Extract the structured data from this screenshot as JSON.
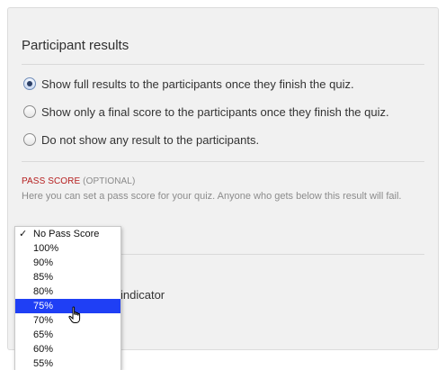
{
  "participant_results": {
    "title": "Participant results",
    "options": [
      {
        "label": "Show full results to the participants once they finish the quiz.",
        "checked": true
      },
      {
        "label": "Show only a final score to the participants once they finish the quiz.",
        "checked": false
      },
      {
        "label": "Do not show any result to the participants.",
        "checked": false
      }
    ]
  },
  "pass_score": {
    "heading": "PASS SCORE",
    "optional_tag": "(OPTIONAL)",
    "help": "Here you can set a pass score for your quiz. Anyone who gets below this result will fail.",
    "dropdown": {
      "selected": "No Pass Score",
      "check_mark": "✓",
      "highlighted": "75%",
      "options": [
        "No Pass Score",
        "100%",
        "90%",
        "85%",
        "80%",
        "75%",
        "70%",
        "65%",
        "60%",
        "55%"
      ]
    }
  },
  "partially_hidden": {
    "indicator_text": "indicator"
  },
  "icons": {
    "cursor": "hand-pointer-icon",
    "check": "checkmark-icon"
  },
  "colors": {
    "required_red": "#b51e1e",
    "highlight_blue": "#1f3ff5",
    "panel_bg": "#f1f1f1"
  }
}
